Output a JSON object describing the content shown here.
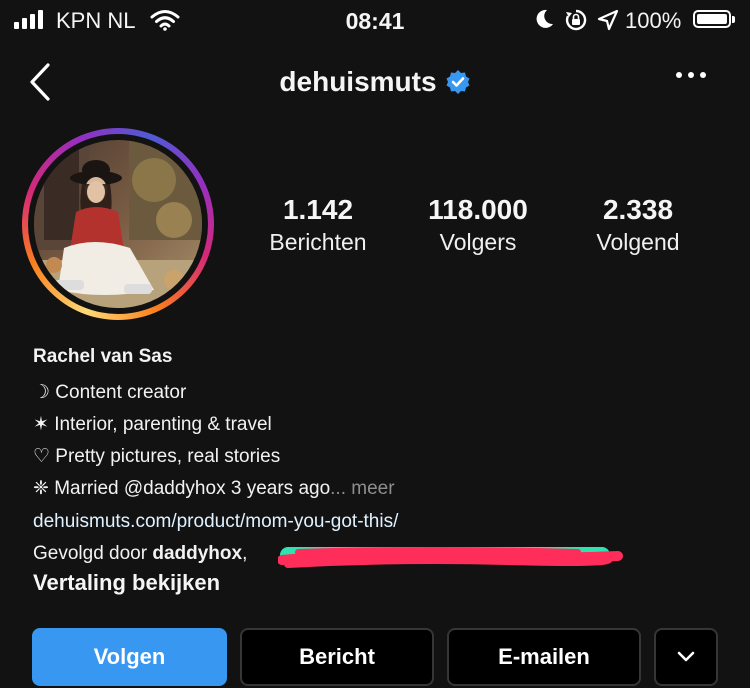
{
  "status_bar": {
    "carrier": "KPN NL",
    "time": "08:41",
    "battery": "100%",
    "icons": [
      "signal-icon",
      "wifi-icon",
      "moon-icon",
      "rotation-lock-icon",
      "location-arrow-icon",
      "battery-icon"
    ]
  },
  "nav": {
    "title": "dehuismuts",
    "verified": true,
    "back_icon": "chevron-left-icon",
    "more_icon": "more-horizontal-icon"
  },
  "stats": {
    "posts": {
      "value": "1.142",
      "label": "Berichten"
    },
    "followers": {
      "value": "118.000",
      "label": "Volgers"
    },
    "following": {
      "value": "2.338",
      "label": "Volgend"
    }
  },
  "bio": {
    "name": "Rachel van Sas",
    "line1": "☽ Content creator",
    "line2": "✶ Interior, parenting & travel",
    "line3": "♡ Pretty pictures, real stories",
    "line4_main": "❈ Married @daddyhox",
    "line4_ago": "3 years ago",
    "line4_more": "... meer",
    "link": "dehuismuts.com/product/mom-you-got-this/",
    "followed_prefix": "Gevolgd door ",
    "followed_by": "daddyhox",
    "followed_sep": ","
  },
  "translate_label": "Vertaling bekijken",
  "actions": {
    "follow": "Volgen",
    "message": "Bericht",
    "email": "E-mailen"
  },
  "colors": {
    "background": "#121212",
    "accent": "#3897f0",
    "verified": "#3897f0",
    "redaction": "#ff2d5a"
  }
}
